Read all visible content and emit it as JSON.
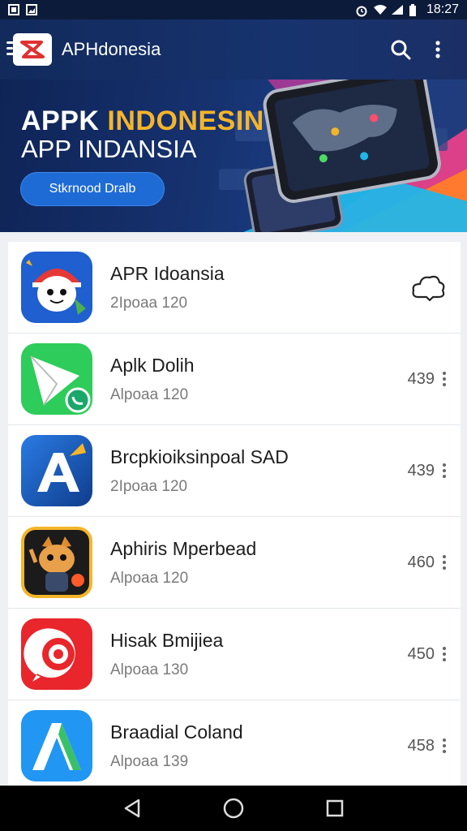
{
  "status_bar": {
    "time": "18:27"
  },
  "app_bar": {
    "title": "APHdonesia"
  },
  "hero": {
    "title_line1_a": "APPK ",
    "title_line1_b": "INDONESIN",
    "title_line2": "APP INDANSIA",
    "button_label": "Stkrnood Dralb"
  },
  "apps": [
    {
      "name": "APR Idoansia",
      "sub": "2Ipoaa 120",
      "value": "",
      "icon": "mascot-icon"
    },
    {
      "name": "Aplk Dolih",
      "sub": "Alpoaa 120",
      "value": "439",
      "icon": "messenger-icon"
    },
    {
      "name": "Brcpkioiksinpoal SAD",
      "sub": "2Ipoaa 120",
      "value": "439",
      "icon": "a-arrow-icon"
    },
    {
      "name": "Aphiris Mperbead",
      "sub": "Alpoaa 120",
      "value": "460",
      "icon": "fox-character-icon"
    },
    {
      "name": "Hisak Bmijiea",
      "sub": "Alpoaa 130",
      "value": "450",
      "icon": "camera-ring-icon"
    },
    {
      "name": "Braadial Coland",
      "sub": "Alpoaa 139",
      "value": "458",
      "icon": "a-logo-icon"
    }
  ],
  "colors": {
    "accent": "#f5b52a",
    "primary": "#1e6bd6",
    "header": "#122a5c"
  }
}
